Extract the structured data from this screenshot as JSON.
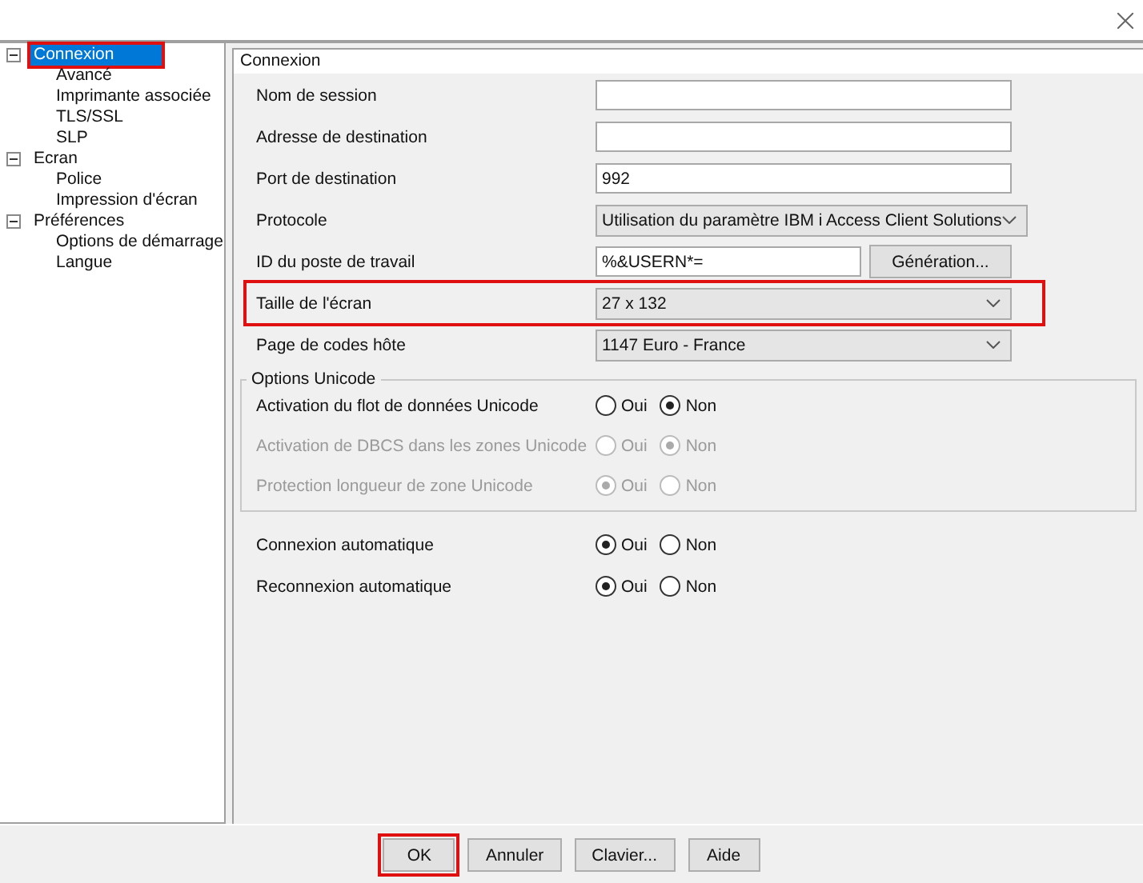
{
  "tree": [
    {
      "label": "Connexion",
      "selected": true,
      "highlighted": true,
      "expanded": true,
      "children": [
        {
          "label": "Avancé",
          "selected": false
        },
        {
          "label": "Imprimante associée",
          "selected": false
        },
        {
          "label": "TLS/SSL",
          "selected": false
        },
        {
          "label": "SLP",
          "selected": false
        }
      ]
    },
    {
      "label": "Ecran",
      "selected": false,
      "highlighted": false,
      "expanded": true,
      "children": [
        {
          "label": "Police",
          "selected": false
        },
        {
          "label": "Impression d'écran",
          "selected": false
        }
      ]
    },
    {
      "label": "Préférences",
      "selected": false,
      "highlighted": false,
      "expanded": true,
      "children": [
        {
          "label": "Options de démarrage",
          "selected": false
        },
        {
          "label": "Langue",
          "selected": false
        }
      ]
    }
  ],
  "panel": {
    "title": "Connexion",
    "rows": [
      {
        "kind": "text",
        "label": "Nom de session",
        "highlighted": false
      },
      {
        "kind": "text",
        "label": "Adresse de destination",
        "highlighted": false
      },
      {
        "kind": "text",
        "label": "Port de destination",
        "value": "992",
        "highlighted": false
      },
      {
        "kind": "combo",
        "label": "Protocole",
        "value": "Utilisation du paramètre IBM i Access Client Solutions",
        "highlighted": false
      },
      {
        "kind": "text_button",
        "label": "ID du poste de travail",
        "value": "%&USERN*=",
        "button": "Génération...",
        "highlighted": false
      },
      {
        "kind": "combo",
        "label": "Taille de l'écran",
        "value": "27 x 132",
        "highlighted": true
      },
      {
        "kind": "combo",
        "label": "Page de codes hôte",
        "value": "1147 Euro - France",
        "highlighted": false
      }
    ],
    "group": {
      "title": "Options Unicode",
      "rows": [
        {
          "kind": "radio",
          "label": "Activation du flot de données Unicode",
          "disabled": false,
          "options": [
            {
              "label": "Oui",
              "selected": false
            },
            {
              "label": "Non",
              "selected": true
            }
          ]
        },
        {
          "kind": "radio",
          "label": "Activation de DBCS dans les zones Unicode",
          "disabled": true,
          "options": [
            {
              "label": "Oui",
              "selected": false
            },
            {
              "label": "Non",
              "selected": true
            }
          ]
        },
        {
          "kind": "radio",
          "label": "Protection longueur de zone Unicode",
          "disabled": true,
          "options": [
            {
              "label": "Oui",
              "selected": true
            },
            {
              "label": "Non",
              "selected": false
            }
          ]
        }
      ]
    },
    "rows_after": [
      {
        "kind": "radio",
        "label": "Connexion automatique",
        "disabled": false,
        "options": [
          {
            "label": "Oui",
            "selected": true
          },
          {
            "label": "Non",
            "selected": false
          }
        ]
      },
      {
        "kind": "radio",
        "label": "Reconnexion automatique",
        "disabled": false,
        "options": [
          {
            "label": "Oui",
            "selected": true
          },
          {
            "label": "Non",
            "selected": false
          }
        ]
      }
    ]
  },
  "buttons": [
    {
      "label": "OK",
      "highlighted": true
    },
    {
      "label": "Annuler",
      "highlighted": false
    },
    {
      "label": "Clavier...",
      "highlighted": false
    },
    {
      "label": "Aide",
      "highlighted": false
    }
  ]
}
